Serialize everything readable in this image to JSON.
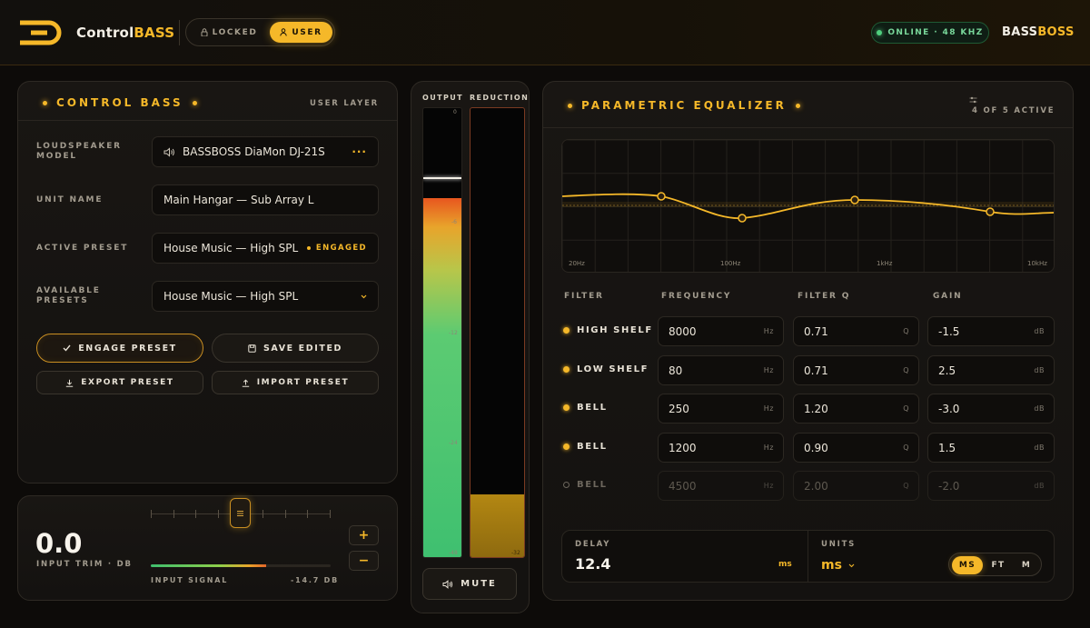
{
  "header": {
    "brand_main": "Control",
    "brand_accent": "BASS",
    "mode_locked": "LOCKED",
    "mode_user": "USER",
    "status": "ONLINE · 48 KHZ",
    "vendor_main": "BASS",
    "vendor_accent": "BOSS",
    "colors": {
      "accent": "#f5b829",
      "online": "#4fcf7e"
    }
  },
  "control_panel": {
    "title": "CONTROL BASS",
    "layer": "USER LAYER",
    "loudspeaker_label_1": "LOUDSPEAKER",
    "loudspeaker_label_2": "MODEL",
    "loudspeaker_value": "BASSBOSS DiaMon DJ-21S",
    "loudspeaker_more": "···",
    "unit_name_label": "UNIT NAME",
    "unit_name_value": "Main Hangar — Sub Array L",
    "active_preset_label": "ACTIVE PRESET",
    "active_preset_value": "House Music — High SPL",
    "active_preset_badge": "ENGAGED",
    "available_label_1": "AVAILABLE",
    "available_label_2": "PRESETS",
    "available_value": "House Music — High SPL",
    "engage_btn": "ENGAGE PRESET",
    "save_btn": "SAVE EDITED",
    "export_btn": "EXPORT PRESET",
    "import_btn": "IMPORT PRESET"
  },
  "trim_panel": {
    "value": "0.0",
    "label": "INPUT TRIM · DB",
    "signal_label": "INPUT SIGNAL",
    "signal_value": "-14.7 DB",
    "signal_level": 0.64,
    "plus": "+",
    "minus": "−"
  },
  "meters": {
    "output_label": "OUTPUT",
    "reduction_label": "REDUCTION",
    "ticks": [
      "0",
      "-6",
      "-12",
      "-24",
      "-48"
    ],
    "reduction_ticks": [
      "-32"
    ],
    "output_level": 0.8,
    "reduction_level": 0.14,
    "mute_label": "MUTE"
  },
  "eq": {
    "title": "PARAMETRIC EQUALIZER",
    "active_count": "4 OF 5 ACTIVE",
    "freq_labels": [
      "20Hz",
      "100Hz",
      "1kHz",
      "10kHz"
    ],
    "headers": {
      "filter": "FILTER",
      "frequency": "FREQUENCY",
      "q": "FILTER Q",
      "gain": "GAIN"
    },
    "units": {
      "freq": "Hz",
      "q": "Q",
      "gain": "dB"
    },
    "bands": [
      {
        "name": "HIGH SHELF",
        "freq": "8000",
        "q": "0.71",
        "gain": "-1.5",
        "active": true
      },
      {
        "name": "LOW SHELF",
        "freq": "80",
        "q": "0.71",
        "gain": "2.5",
        "active": true
      },
      {
        "name": "BELL",
        "freq": "250",
        "q": "1.20",
        "gain": "-3.0",
        "active": true
      },
      {
        "name": "BELL",
        "freq": "1200",
        "q": "0.90",
        "gain": "1.5",
        "active": true
      },
      {
        "name": "BELL",
        "freq": "4500",
        "q": "2.00",
        "gain": "-2.0",
        "active": false
      }
    ],
    "delay_label": "DELAY",
    "delay_value": "12.4",
    "delay_unit": "ms",
    "units_label": "UNITS",
    "units_value": "ms",
    "units_options": [
      "MS",
      "FT",
      "M"
    ]
  }
}
